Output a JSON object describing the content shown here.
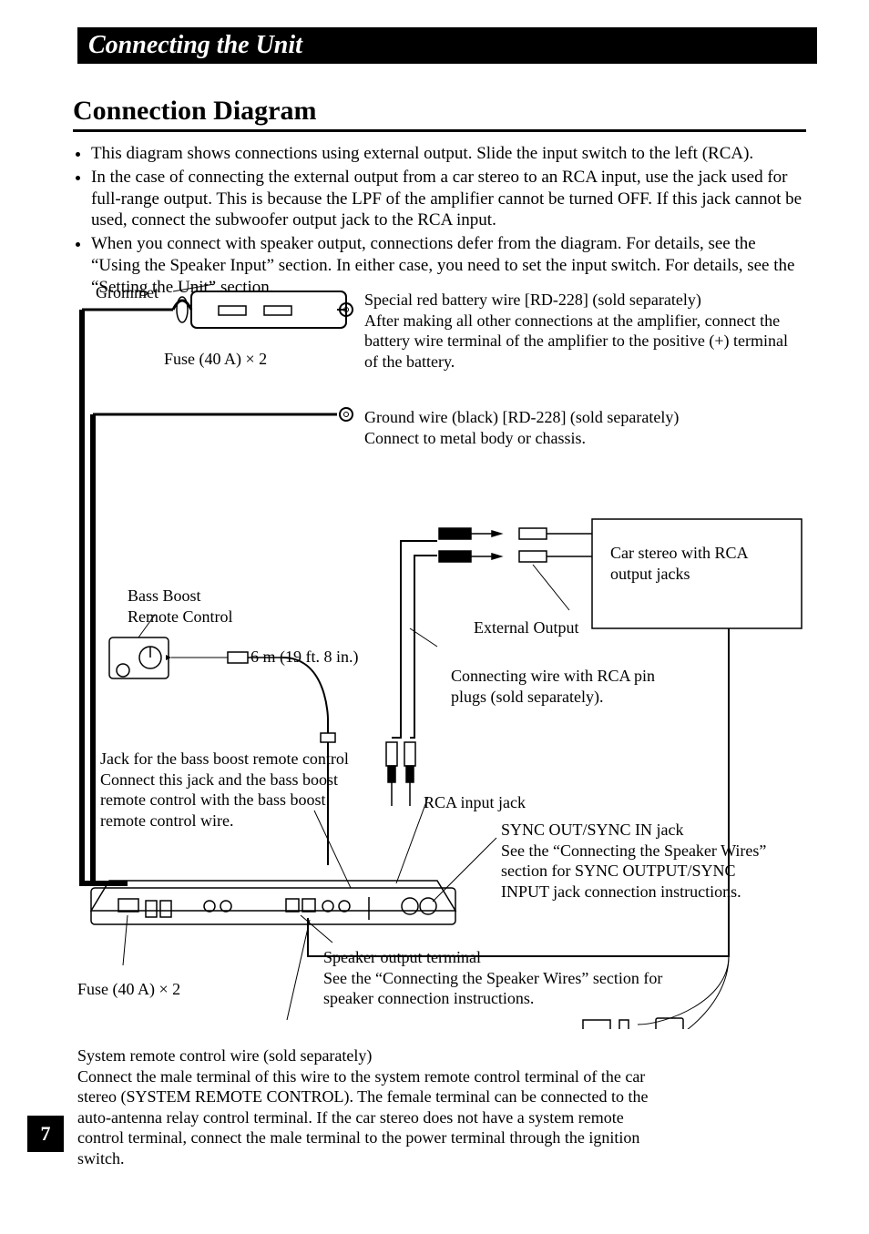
{
  "page_number": "7",
  "header": {
    "section": "Connecting the Unit",
    "title": "Connection Diagram"
  },
  "bullets": [
    "This diagram shows connections using external output. Slide the input switch to the left (RCA).",
    "In the case of connecting the external output from a car stereo to an RCA input, use the jack used for full-range output. This is because the LPF of the amplifier cannot be turned OFF. If this jack cannot be used, connect the subwoofer output jack to the RCA input.",
    "When you connect with speaker output, connections defer from the diagram. For details, see the “Using the Speaker Input” section. In either case, you need to set the input switch. For details, see the “Setting the Unit” section."
  ],
  "labels": {
    "grommet": "Grommet",
    "fuse_top": "Fuse (40 A) × 2",
    "fuse_bottom": "Fuse (40 A) × 2",
    "battery_note": "Special red battery wire [RD-228] (sold separately)\nAfter making all other connections at the amplifier, connect the battery wire terminal of the amplifier to the positive (+) terminal of the battery.",
    "ground_note": "Ground wire (black) [RD-228] (sold separately)\nConnect to metal body or chassis.",
    "car_stereo": "Car stereo with RCA output jacks",
    "external_output": "External Output",
    "rca_wire": "Connecting wire with RCA pin plugs (sold separately).",
    "bass_boost": "Bass Boost\nRemote Control",
    "cable_length": "6 m (19 ft. 8 in.)",
    "jack_bass": "Jack for the bass boost remote control\nConnect this jack and the bass boost remote control with the bass boost remote control wire.",
    "rca_input": "RCA input jack",
    "sync": "SYNC OUT/SYNC IN  jack\nSee the “Connecting the Speaker Wires” section for SYNC OUTPUT/SYNC INPUT jack connection instructions.",
    "speaker_out": "Speaker output terminal\nSee the “Connecting the Speaker Wires” section for speaker connection instructions.",
    "system_remote": "System remote control wire (sold separately)\nConnect the male terminal of this wire to the system remote control terminal of the car stereo (SYSTEM REMOTE CONTROL). The female terminal can be connected to the auto-antenna relay control terminal. If the car stereo does not have a system remote control terminal, connect the male terminal to the power terminal through the ignition switch."
  }
}
